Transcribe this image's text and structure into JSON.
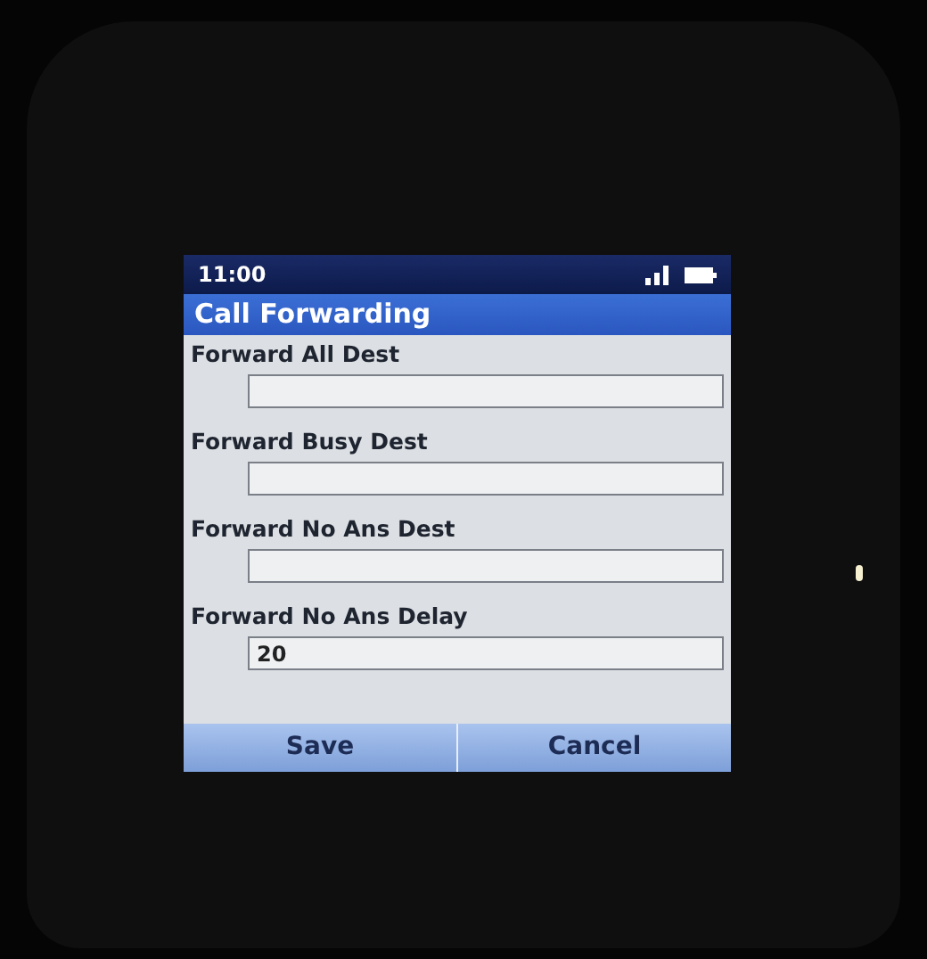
{
  "status_bar": {
    "time": "11:00"
  },
  "title": "Call Forwarding",
  "fields": [
    {
      "label": "Forward All Dest"
    },
    {
      "label": "Forward Busy Dest"
    },
    {
      "label": "Forward No Ans Dest"
    },
    {
      "label": "Forward No Ans Delay",
      "value": "20"
    }
  ],
  "softkeys": [
    "Save",
    "Cancel"
  ]
}
